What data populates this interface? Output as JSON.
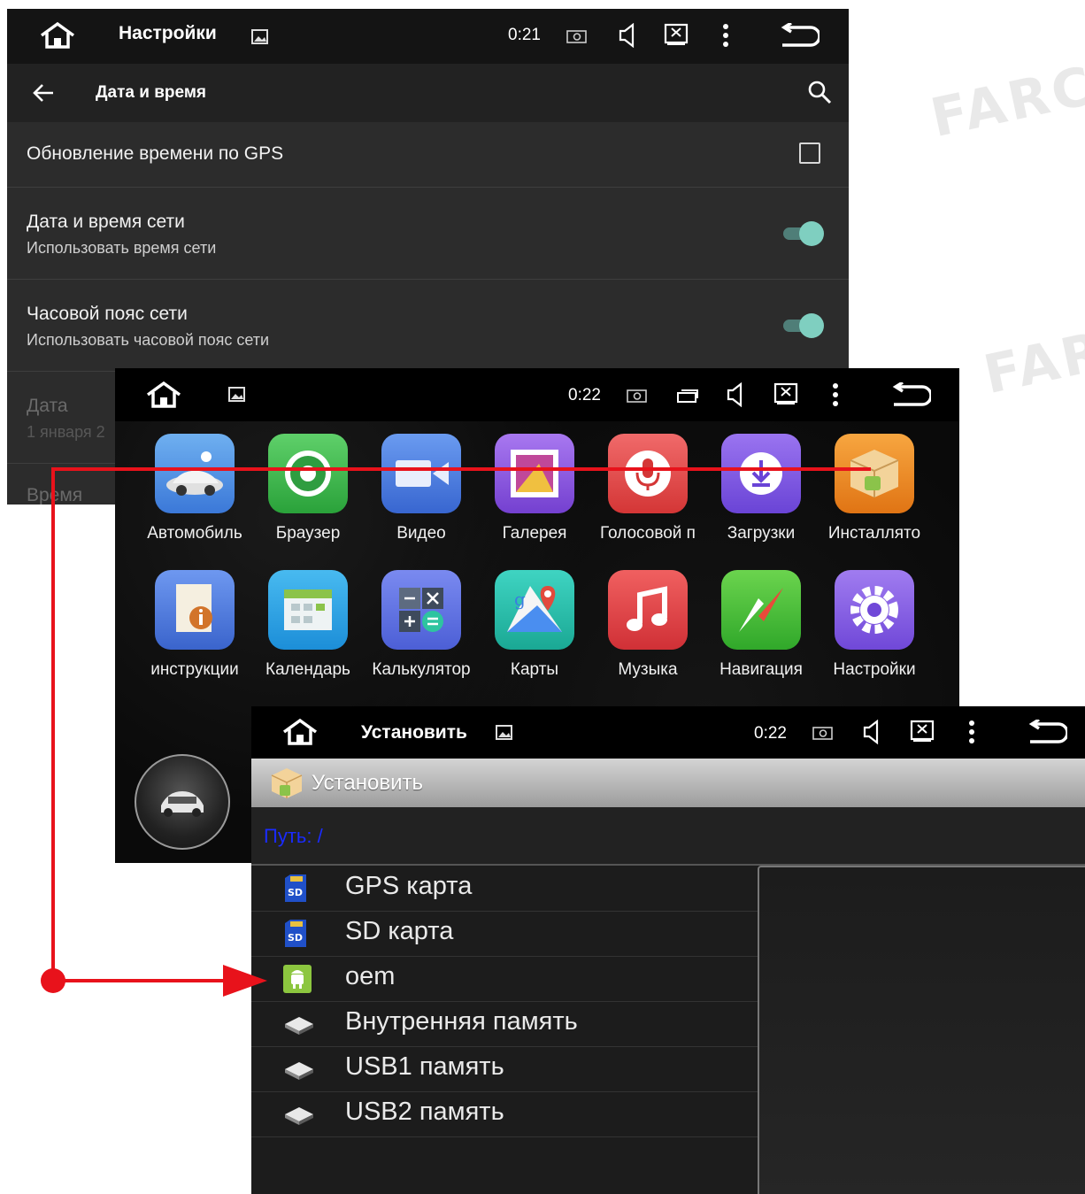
{
  "watermark": "FARCAR",
  "settings_screen": {
    "statusbar": {
      "title": "Настройки",
      "time": "0:21"
    },
    "appbar": {
      "title": "Дата и время"
    },
    "rows": [
      {
        "title": "Обновление времени по GPS",
        "control": "checkbox",
        "checked": false
      },
      {
        "title": "Дата и время сети",
        "subtitle": "Использовать время сети",
        "control": "switch",
        "on": true
      },
      {
        "title": "Часовой пояс сети",
        "subtitle": "Использовать часовой пояс сети",
        "control": "switch",
        "on": true
      },
      {
        "title": "Дата",
        "subtitle": "1 января 2",
        "disabled": true
      },
      {
        "title": "Время",
        "disabled": true
      }
    ]
  },
  "launcher_screen": {
    "statusbar": {
      "time": "0:22"
    },
    "apps": [
      {
        "label": "Автомобиль",
        "color": "#4a90e2"
      },
      {
        "label": "Браузер",
        "color": "#3cb54a"
      },
      {
        "label": "Видео",
        "color": "#4c7fe0"
      },
      {
        "label": "Галерея",
        "color": "#8e4fd6"
      },
      {
        "label": "Голосовой п",
        "color": "#e24a4a"
      },
      {
        "label": "Загрузки",
        "color": "#7b52e0"
      },
      {
        "label": "Инсталлято",
        "color": "#f08a1e"
      },
      {
        "label": "инструкции",
        "color": "#4f7fe0"
      },
      {
        "label": "Календарь",
        "color": "#2aa6e8"
      },
      {
        "label": "Калькулятор",
        "color": "#5a6fe0"
      },
      {
        "label": "Карты",
        "color": "#27c0b0"
      },
      {
        "label": "Музыка",
        "color": "#e5444c"
      },
      {
        "label": "Навигация",
        "color": "#3fbf3a"
      },
      {
        "label": "Настройки",
        "color": "#8a5be0"
      }
    ]
  },
  "install_screen": {
    "statusbar": {
      "title": "Установить",
      "time": "0:22"
    },
    "header": {
      "label": "Установить"
    },
    "path": {
      "label": "Путь:  /"
    },
    "items": [
      {
        "label": "GPS карта",
        "icon": "sd-card-icon"
      },
      {
        "label": "SD карта",
        "icon": "sd-card-icon"
      },
      {
        "label": "oem",
        "icon": "android-oem-icon"
      },
      {
        "label": "Внутренняя память",
        "icon": "storage-icon"
      },
      {
        "label": "USB1 память",
        "icon": "storage-icon"
      },
      {
        "label": "USB2 память",
        "icon": "storage-icon"
      }
    ]
  },
  "annotation": {
    "color": "#e8121b"
  }
}
